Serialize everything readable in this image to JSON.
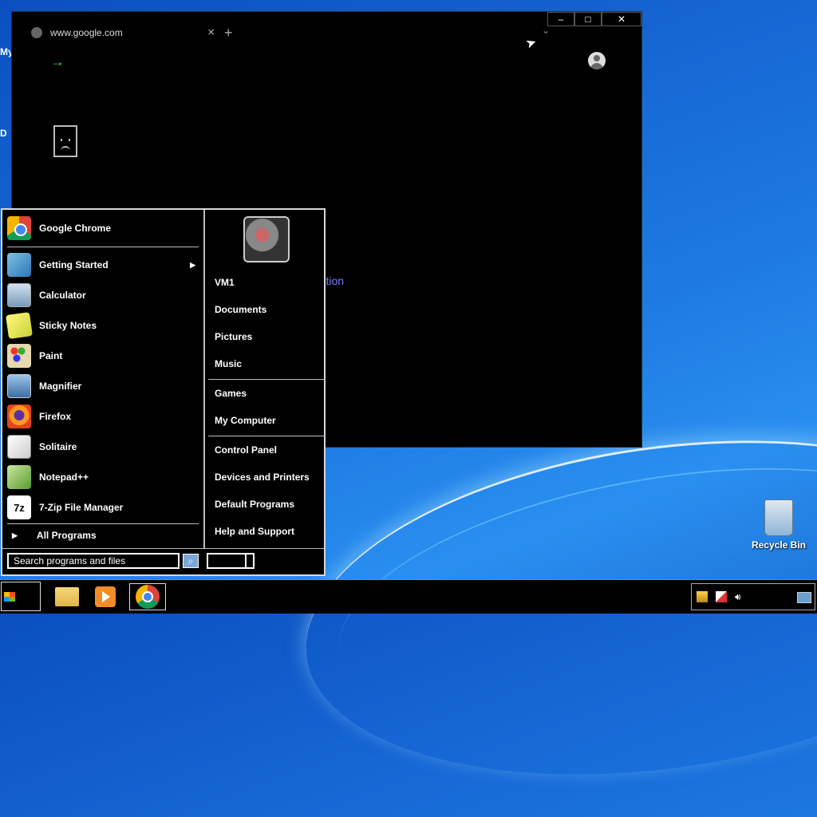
{
  "desktop": {
    "edge_labels": [
      "My",
      "D"
    ],
    "recycle_bin_label": "Recycle Bin"
  },
  "browser": {
    "tab_title": "www.google.com",
    "tab_close": "×",
    "new_tab": "+",
    "tab_menu": "⌄",
    "controls": {
      "minimize": "–",
      "maximize": "□",
      "close": "✕"
    },
    "go_arrow": "→",
    "partial_link_text": "ration"
  },
  "start_menu": {
    "pinned": [
      {
        "label": "Google Chrome",
        "icon": "chrome-icon"
      }
    ],
    "programs": [
      {
        "label": "Getting Started",
        "icon": "getting-started-icon",
        "submenu": true
      },
      {
        "label": "Calculator",
        "icon": "calculator-icon"
      },
      {
        "label": "Sticky Notes",
        "icon": "sticky-notes-icon"
      },
      {
        "label": "Paint",
        "icon": "paint-icon"
      },
      {
        "label": "Magnifier",
        "icon": "magnifier-icon"
      },
      {
        "label": "Firefox",
        "icon": "firefox-icon"
      },
      {
        "label": "Solitaire",
        "icon": "solitaire-icon"
      },
      {
        "label": "Notepad++",
        "icon": "notepadpp-icon"
      },
      {
        "label": "7-Zip File Manager",
        "icon": "7zip-icon"
      }
    ],
    "all_programs": "All Programs",
    "search_placeholder": "Search programs and files",
    "right": {
      "user": "VM1",
      "group1": [
        "Documents",
        "Pictures",
        "Music"
      ],
      "group2": [
        "Games",
        "My Computer"
      ],
      "group3": [
        "Control Panel",
        "Devices and Printers",
        "Default Programs",
        "Help and Support"
      ]
    }
  },
  "taskbar": {
    "apps": [
      {
        "name": "windows-explorer",
        "icon": "folder-icon",
        "active": false
      },
      {
        "name": "media-player",
        "icon": "media-player-icon",
        "active": false
      },
      {
        "name": "google-chrome",
        "icon": "chrome-icon",
        "active": true
      }
    ],
    "tray_icons": [
      "network-icon",
      "action-center-flag-icon",
      "volume-icon"
    ]
  }
}
